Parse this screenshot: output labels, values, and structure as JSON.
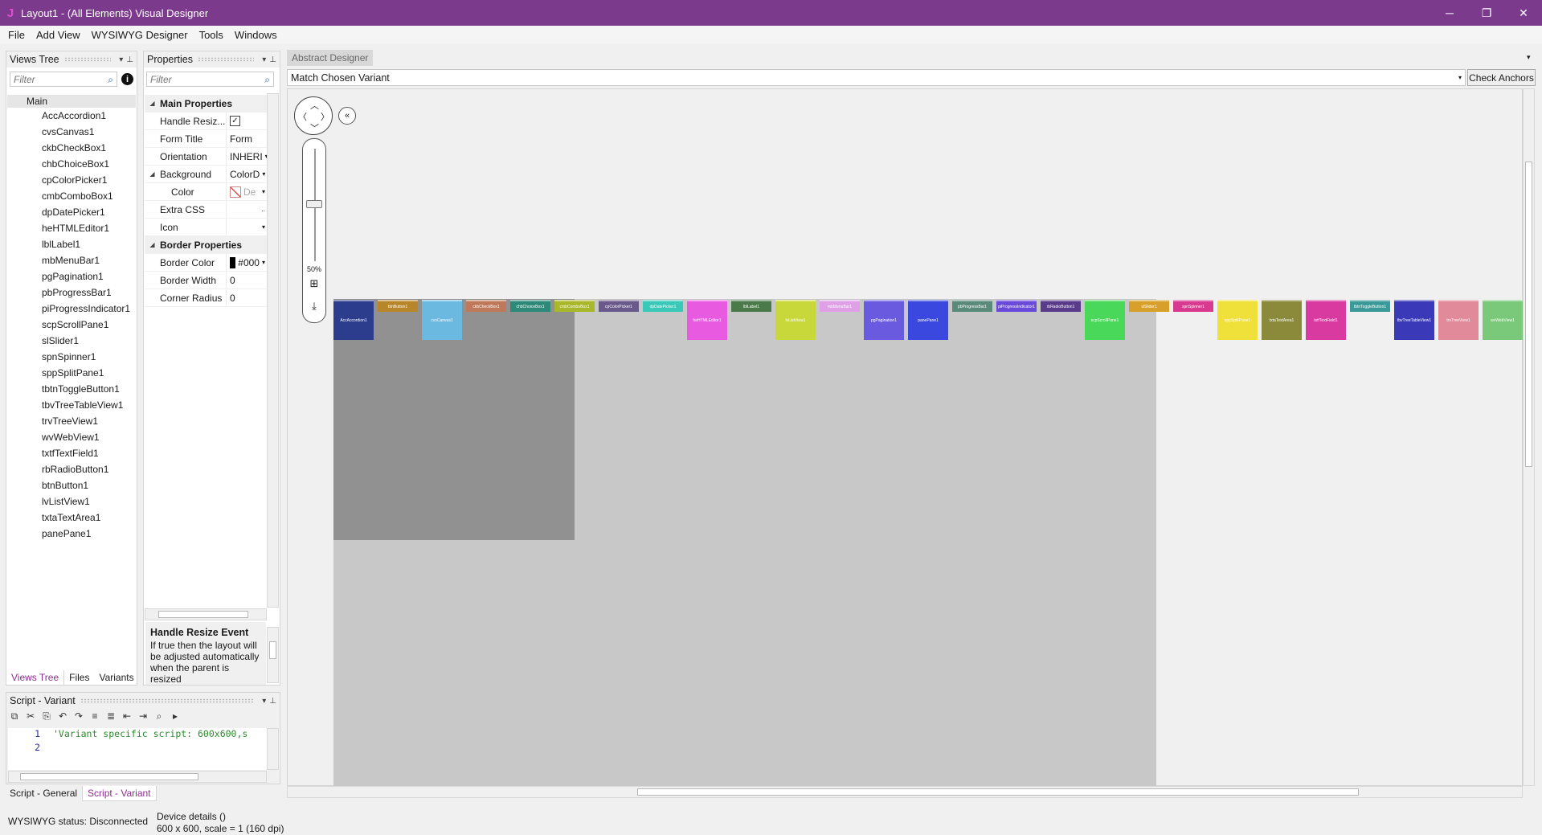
{
  "window": {
    "title": "Layout1 - (All Elements) Visual Designer",
    "app_icon": "J",
    "minimize": "─",
    "restore": "❐",
    "close": "✕"
  },
  "menu": [
    "File",
    "Add View",
    "WYSIWYG Designer",
    "Tools",
    "Windows"
  ],
  "views_tree": {
    "header": "Views Tree",
    "filter_placeholder": "Filter",
    "root": "Main",
    "items": [
      "AccAccordion1",
      "cvsCanvas1",
      "ckbCheckBox1",
      "chbChoiceBox1",
      "cpColorPicker1",
      "cmbComboBox1",
      "dpDatePicker1",
      "heHTMLEditor1",
      "lblLabel1",
      "mbMenuBar1",
      "pgPagination1",
      "pbProgressBar1",
      "piProgressIndicator1",
      "scpScrollPane1",
      "slSlider1",
      "spnSpinner1",
      "sppSplitPane1",
      "tbtnToggleButton1",
      "tbvTreeTableView1",
      "trvTreeView1",
      "wvWebView1",
      "txtfTextField1",
      "rbRadioButton1",
      "btnButton1",
      "lvListView1",
      "txtaTextArea1",
      "panePane1"
    ],
    "tabs": [
      "Views Tree",
      "Files",
      "Variants"
    ]
  },
  "properties": {
    "header": "Properties",
    "filter_placeholder": "Filter",
    "main_section": "Main Properties",
    "handle_resize": "Handle Resiz...",
    "form_title_label": "Form Title",
    "form_title_value": "Form",
    "orientation_label": "Orientation",
    "orientation_value": "INHERI",
    "background_label": "Background",
    "background_value": "ColorD",
    "color_label": "Color",
    "color_value": "De",
    "extra_css_label": "Extra CSS",
    "extra_css_value": "..",
    "icon_label": "Icon",
    "border_section": "Border Properties",
    "border_color_label": "Border Color",
    "border_color_value": "#000",
    "border_width_label": "Border Width",
    "border_width_value": "0",
    "corner_radius_label": "Corner Radius",
    "corner_radius_value": "0",
    "description_title": "Handle Resize Event",
    "description_text": "If true then the layout will be adjusted automatically when the parent is resized"
  },
  "script": {
    "header": "Script - Variant",
    "lines": [
      {
        "n": "1",
        "text": "'Variant specific script: 600x600,s"
      },
      {
        "n": "2",
        "text": ""
      }
    ],
    "tabs": [
      "Script - General",
      "Script - Variant"
    ]
  },
  "status": {
    "wysiwyg": "WYSIWYG status: Disconnected",
    "device_line1": "Device details ()",
    "device_line2": "600 x 600, scale = 1 (160 dpi)"
  },
  "designer": {
    "tab": "Abstract Designer",
    "variant": "Match Chosen Variant",
    "check_anchors": "Check Anchors",
    "zoom": "50%",
    "components": [
      {
        "label": "AccAccordion1",
        "color": "#2b3d8c",
        "tall": true
      },
      {
        "label": "btnButton1",
        "color": "#b8862a",
        "tall": false
      },
      {
        "label": "cvsCanvas1",
        "color": "#6bb8e0",
        "tall": true
      },
      {
        "label": "ckbCheckBox1",
        "color": "#c0785a",
        "tall": false
      },
      {
        "label": "chbChoiceBox1",
        "color": "#2e8a78",
        "tall": false
      },
      {
        "label": "cmbComboBox1",
        "color": "#a8b82a",
        "tall": false
      },
      {
        "label": "cpColorPicker1",
        "color": "#6a5a8c",
        "tall": false
      },
      {
        "label": "dpDatePicker1",
        "color": "#3ac8b8",
        "tall": false
      },
      {
        "label": "heHTMLEditor1",
        "color": "#e85ae0",
        "tall": true
      },
      {
        "label": "lblLabel1",
        "color": "#4a7a4a",
        "tall": false
      },
      {
        "label": "lvListView1",
        "color": "#c8d83a",
        "tall": true
      },
      {
        "label": "mbMenuBar1",
        "color": "#e0a0e8",
        "tall": false
      },
      {
        "label": "pgPagination1",
        "color": "#6a5ae0",
        "tall": true
      },
      {
        "label": "panePane1",
        "color": "#3a48e0",
        "tall": true
      },
      {
        "label": "pbProgressBar1",
        "color": "#5a8a7a",
        "tall": false
      },
      {
        "label": "piProgressIndicator1",
        "color": "#6a4ad8",
        "tall": false
      },
      {
        "label": "rbRadioButton1",
        "color": "#5a3a8a",
        "tall": false
      },
      {
        "label": "scpScrollPane1",
        "color": "#4ad85a",
        "tall": true
      },
      {
        "label": "slSlider1",
        "color": "#d8a02a",
        "tall": false
      },
      {
        "label": "spnSpinner1",
        "color": "#d83a90",
        "tall": false
      },
      {
        "label": "sppSplitPane1",
        "color": "#f0e03a",
        "tall": true
      },
      {
        "label": "txtaTextArea1",
        "color": "#8a8a3a",
        "tall": true
      },
      {
        "label": "txtfTextField1",
        "color": "#d83aa0",
        "tall": true
      },
      {
        "label": "tbtnToggleButton1",
        "color": "#3a9a9a",
        "tall": false
      },
      {
        "label": "tbvTreeTableView1",
        "color": "#3a3ab8",
        "tall": true
      },
      {
        "label": "trvTreeView1",
        "color": "#e08a9a",
        "tall": true
      },
      {
        "label": "wvWebView1",
        "color": "#7ac87a",
        "tall": true
      }
    ]
  }
}
